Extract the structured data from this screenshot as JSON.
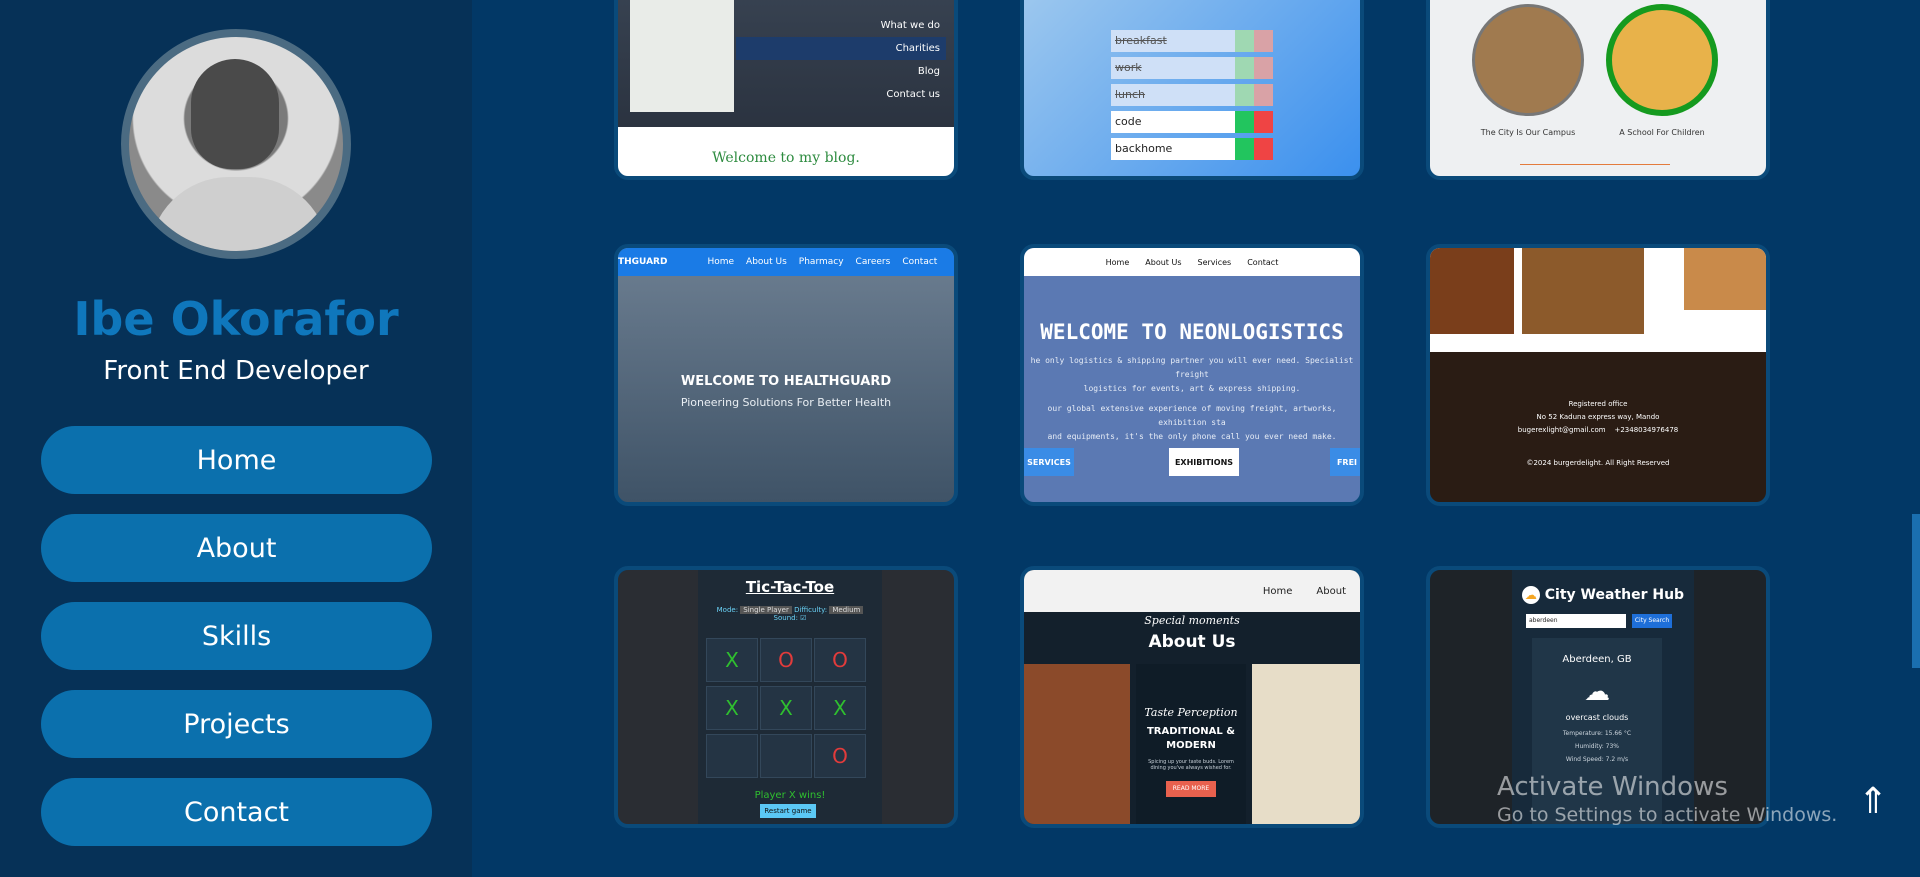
{
  "profile": {
    "name": "Ibe Okorafor",
    "role": "Front End Developer"
  },
  "nav": [
    {
      "label": "Home"
    },
    {
      "label": "About"
    },
    {
      "label": "Skills"
    },
    {
      "label": "Projects"
    },
    {
      "label": "Contact"
    }
  ],
  "projects": {
    "blog": {
      "menu": [
        "What we do",
        "Charities",
        "Blog",
        "Contact us"
      ],
      "welcome": "Welcome to my blog."
    },
    "todo": {
      "items": [
        {
          "text": "breakfast",
          "done": true
        },
        {
          "text": "work",
          "done": true
        },
        {
          "text": "lunch",
          "done": true
        },
        {
          "text": "code",
          "done": false
        },
        {
          "text": "backhome",
          "done": false
        }
      ]
    },
    "campus": {
      "labels": [
        "The City Is Our Campus",
        "A School For Children"
      ]
    },
    "healthguard": {
      "brand": "THGUARD",
      "nav": [
        "Home",
        "About Us",
        "Pharmacy",
        "Careers",
        "Contact"
      ],
      "title": "WELCOME TO HEALTHGUARD",
      "subtitle": "Pioneering Solutions For Better Health"
    },
    "neonlogistics": {
      "nav": [
        "Home",
        "About Us",
        "Services",
        "Contact"
      ],
      "title": "WELCOME TO NEONLOGISTICS",
      "desc1": "he only logistics & shipping partner you will ever need. Specialist freight",
      "desc2": "logistics for events, art & express shipping.",
      "desc3": "our global extensive experience of moving freight, artworks, exhibition sta",
      "desc4": "and equipments, it's the only phone call you ever need make.",
      "btn_left": "SERVICES",
      "btn_mid": "EXHIBITIONS",
      "btn_right": "FREI"
    },
    "burger": {
      "office": "Registered office",
      "address": "No 52 Kaduna express way, Mando",
      "email": "bugerexlight@gmail.com",
      "phone": "+2348034976478",
      "copyright": "©2024 burgerdelight. All Right Reserved"
    },
    "tictactoe": {
      "title": "Tic-Tac-Toe",
      "mode_label": "Mode:",
      "mode_value": "Single Player",
      "difficulty_label": "Difficulty:",
      "difficulty_value": "Medium",
      "sound_label": "Sound:",
      "cells": [
        "X",
        "O",
        "O",
        "X",
        "X",
        "X",
        "",
        "",
        "O"
      ],
      "winner": "Player X wins!",
      "restart": "Restart game"
    },
    "restaurant": {
      "nav": [
        "Home",
        "About"
      ],
      "special": "Special moments",
      "about": "About Us",
      "taste": "Taste Perception",
      "heading": "TRADITIONAL & MODERN",
      "blurb": "Spicing up your taste buds. Lorem dining you've always wished for.",
      "read_more": "READ MORE"
    },
    "weather": {
      "title": "City Weather Hub",
      "input": "aberdeen",
      "search": "City Search",
      "city": "Aberdeen, GB",
      "condition": "overcast clouds",
      "temperature": "Temperature: 15.66 °C",
      "humidity": "Humidity: 73%",
      "wind": "Wind Speed: 7.2 m/s"
    }
  },
  "windows": {
    "line1": "Activate Windows",
    "line2": "Go to Settings to activate Windows."
  },
  "colors": {
    "background": "#023866",
    "sidebar": "#063157",
    "accent": "#0b70ad",
    "name": "#0f77bc"
  }
}
